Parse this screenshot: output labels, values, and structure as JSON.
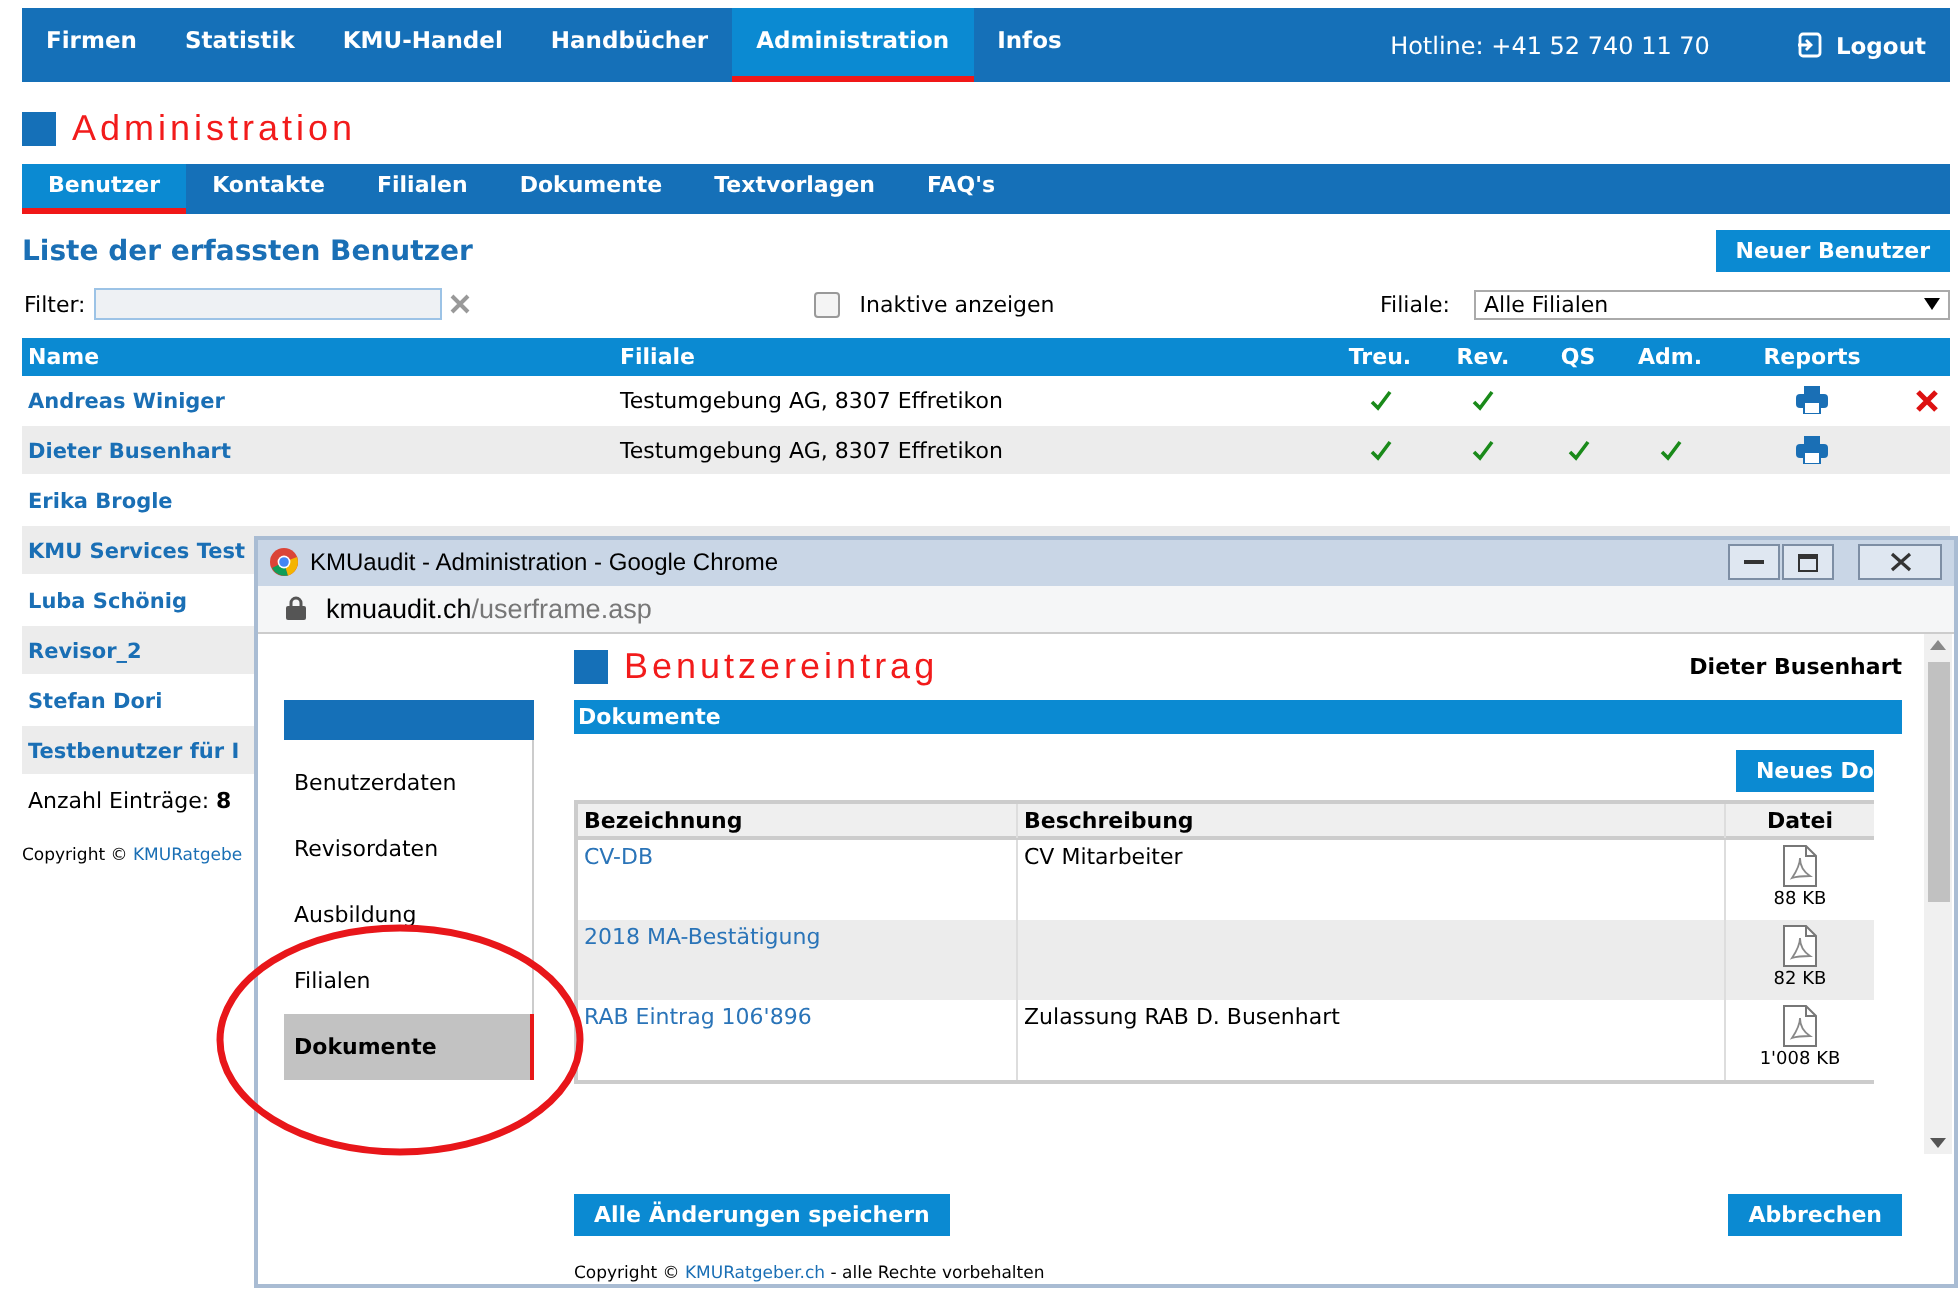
{
  "top_nav": {
    "items": [
      {
        "label": "Firmen",
        "selected": false
      },
      {
        "label": "Statistik",
        "selected": false
      },
      {
        "label": "KMU-Handel",
        "selected": false
      },
      {
        "label": "Handbücher",
        "selected": false
      },
      {
        "label": "Administration",
        "selected": true
      },
      {
        "label": "Infos",
        "selected": false
      }
    ],
    "hotline": "Hotline: +41 52 740 11 70",
    "logout": "Logout"
  },
  "page_title": "Administration",
  "sub_nav": [
    {
      "label": "Benutzer",
      "selected": true
    },
    {
      "label": "Kontakte",
      "selected": false
    },
    {
      "label": "Filialen",
      "selected": false
    },
    {
      "label": "Dokumente",
      "selected": false
    },
    {
      "label": "Textvorlagen",
      "selected": false
    },
    {
      "label": "FAQ's",
      "selected": false
    }
  ],
  "list_title": "Liste der erfassten Benutzer",
  "new_user_button": "Neuer Benutzer",
  "filter": {
    "label": "Filter:",
    "inactive_label": "Inaktive anzeigen",
    "inactive_checked": false,
    "branch_label": "Filiale:",
    "branch_value": "Alle Filialen"
  },
  "table": {
    "columns": [
      "Name",
      "Filiale",
      "Treu.",
      "Rev.",
      "QS",
      "Adm.",
      "Reports"
    ],
    "rows": [
      {
        "name": "Andreas Winiger",
        "filiale": "Testumgebung AG, 8307 Effretikon",
        "treu": true,
        "rev": true,
        "qs": false,
        "adm": false,
        "deletable": true
      },
      {
        "name": "Dieter Busenhart",
        "filiale": "Testumgebung AG, 8307 Effretikon",
        "treu": true,
        "rev": true,
        "qs": true,
        "adm": true,
        "deletable": false
      },
      {
        "name": "Erika Brogle"
      },
      {
        "name": "KMU Services Test"
      },
      {
        "name": "Luba Schönig"
      },
      {
        "name": "Revisor_2"
      },
      {
        "name": "Stefan Dori"
      },
      {
        "name": "Testbenutzer für I"
      }
    ]
  },
  "count_label": "Anzahl Einträge:",
  "count": "8",
  "copyright": {
    "text": "Copyright ©",
    "link": "KMURatgebe"
  },
  "popup": {
    "title": "KMUaudit - Administration - Google Chrome",
    "url_host": "kmuaudit.ch",
    "url_path": "/userframe.asp",
    "sidebar": [
      {
        "label": "Benutzerdaten",
        "selected": false
      },
      {
        "label": "Revisordaten",
        "selected": false
      },
      {
        "label": "Ausbildung",
        "selected": false
      },
      {
        "label": "Filialen",
        "selected": false
      },
      {
        "label": "Dokumente",
        "selected": true
      }
    ],
    "heading": "Benutzereintrag",
    "user": "Dieter Busenhart",
    "section": "Dokumente",
    "new_doc_button": "Neues Do",
    "doc_columns": [
      "Bezeichnung",
      "Beschreibung",
      "Datei"
    ],
    "docs": [
      {
        "name": "CV-DB",
        "description": "CV Mitarbeiter",
        "size": "88 KB"
      },
      {
        "name": "2018 MA-Bestätigung",
        "size": "82 KB"
      },
      {
        "name": "RAB Eintrag 106'896",
        "description": "Zulassung RAB D. Busenhart",
        "size": "1'008 KB"
      }
    ],
    "save_button": "Alle Änderungen speichern",
    "cancel_button": "Abbrechen",
    "copyright": {
      "text": "Copyright ©",
      "link": "KMURatgeber.ch",
      "rest": "- alle Rechte vorbehalten"
    }
  }
}
